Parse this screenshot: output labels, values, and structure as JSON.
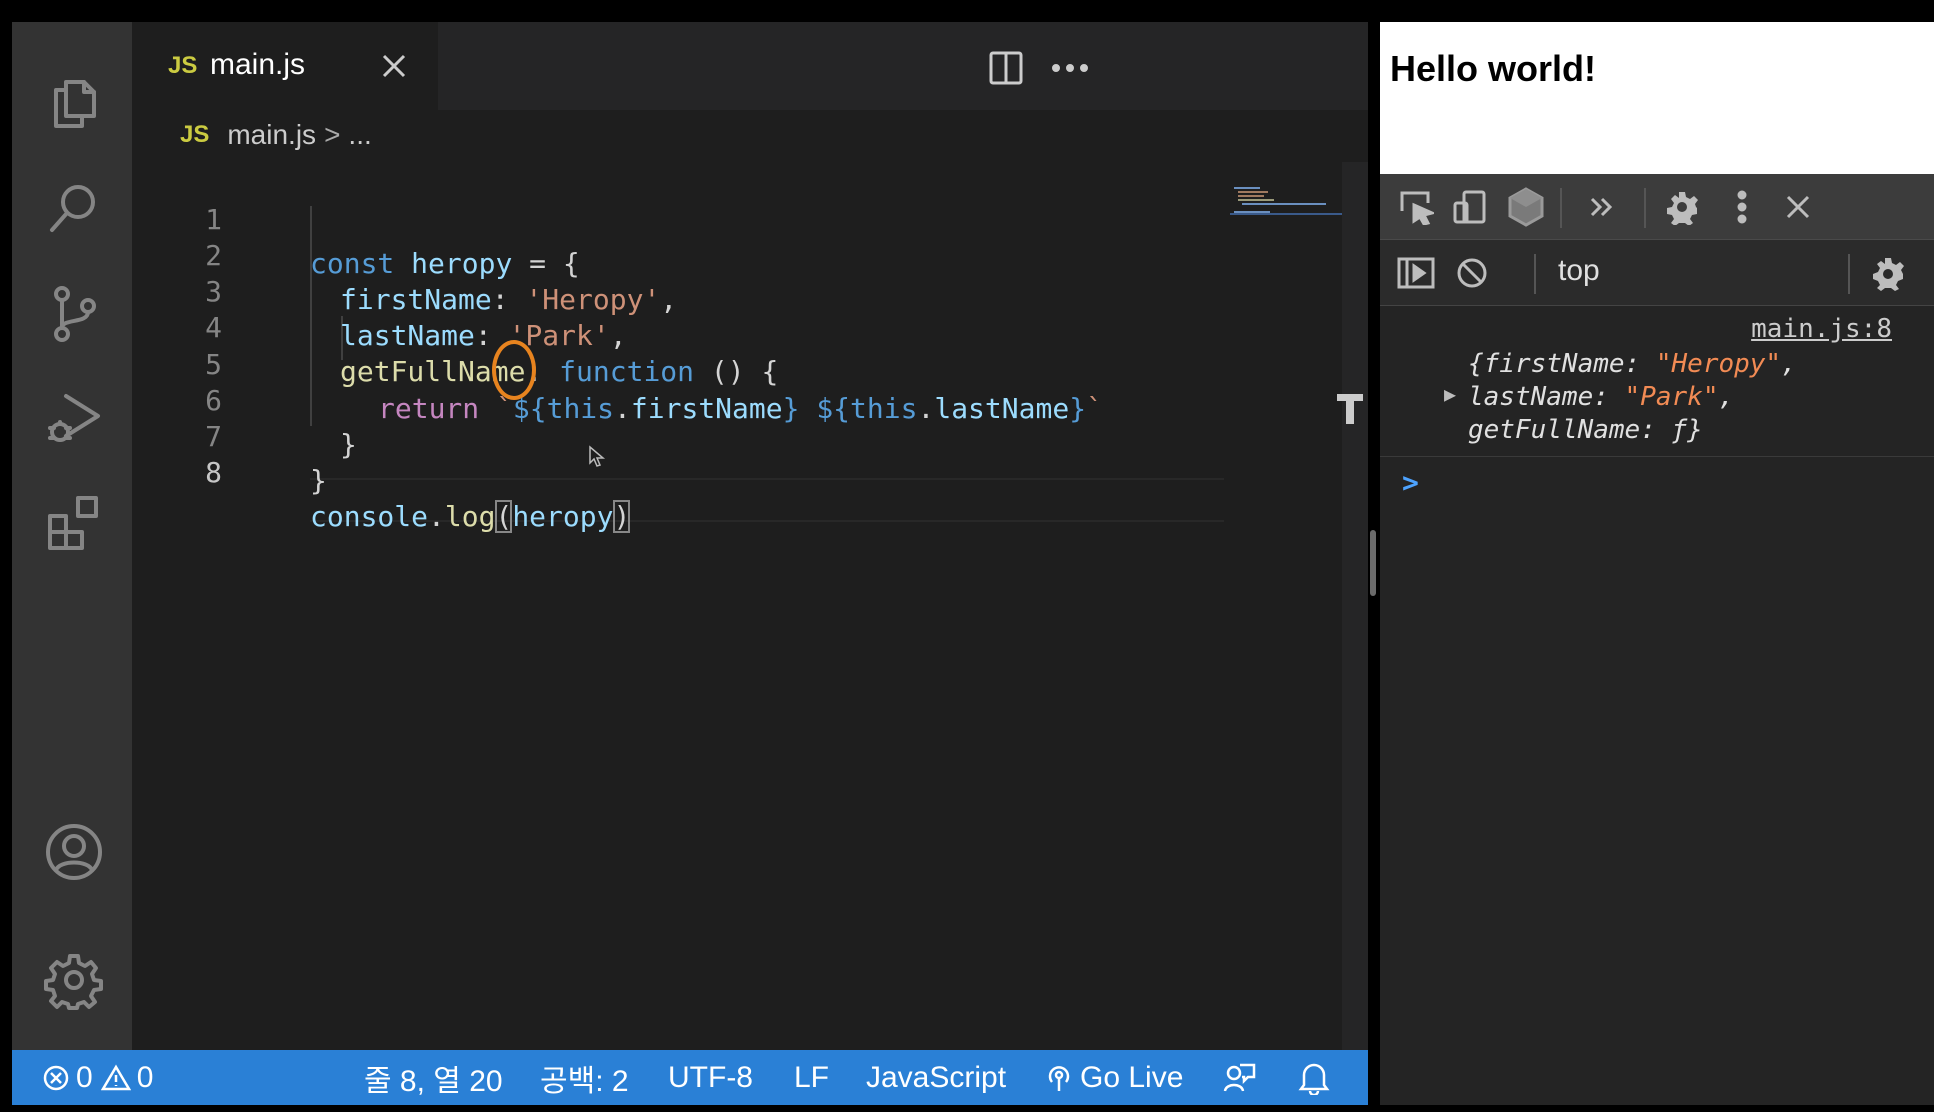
{
  "editor": {
    "tab": {
      "badge": "JS",
      "label": "main.js"
    },
    "breadcrumb": {
      "badge": "JS",
      "file": "main.js",
      "sep": ">",
      "rest": "..."
    },
    "line_numbers": [
      "1",
      "2",
      "3",
      "4",
      "5",
      "6",
      "7",
      "8"
    ],
    "code": {
      "l1": {
        "kw": "const",
        "var": "heropy",
        "rest": " = {"
      },
      "l2": {
        "prop": "firstName",
        "colon": ": ",
        "str": "'Heropy'",
        "end": ","
      },
      "l3": {
        "prop": "lastName",
        "colon": ": ",
        "str": "'Park'",
        "end": ","
      },
      "l4": {
        "fn": "getFullName",
        "colon": ": ",
        "kw": "function",
        "rest": " () {"
      },
      "l5": {
        "ctrl": "return",
        "tick_open": " `",
        "d1": "${",
        "this1": "this",
        "dot1": ".",
        "p1": "firstName",
        "c1": "}",
        "space": " ",
        "d2": "${",
        "this2": "this",
        "dot2": ".",
        "p2": "lastName",
        "c2": "}",
        "tick_close": "`"
      },
      "l6": {
        "text": "}"
      },
      "l7": {
        "text": "}"
      },
      "l8": {
        "var": "console",
        "dot": ".",
        "fn": "log",
        "open": "(",
        "arg": "heropy",
        "close": ")"
      }
    }
  },
  "status_bar": {
    "errors": "0",
    "warnings": "0",
    "position": "줄 8, 열 20",
    "spaces": "공백: 2",
    "encoding": "UTF-8",
    "eol": "LF",
    "language": "JavaScript",
    "go_live": "Go Live"
  },
  "browser": {
    "heading": "Hello world!"
  },
  "devtools": {
    "context": "top",
    "log_source": "main.js:8",
    "log": {
      "open": "{",
      "k1": "firstName",
      "v1": "\"Heropy\"",
      "k2": "lastName",
      "v2": "\"Park\"",
      "k3": "getFullName",
      "v3": "ƒ",
      "close": "}"
    },
    "prompt": ">"
  },
  "colors": {
    "status_bar": "#2a80d6",
    "js_badge": "#cbcb41",
    "highlight_circle": "#e8841f"
  }
}
